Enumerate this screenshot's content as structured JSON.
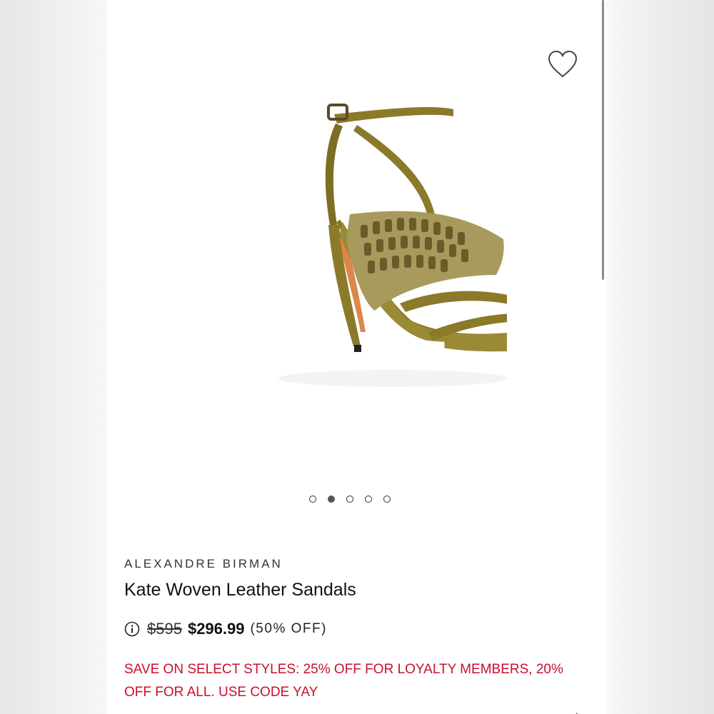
{
  "product": {
    "brand": "ALEXANDRE BIRMAN",
    "title": "Kate Woven Leather Sandals",
    "image_icon": "olive-strappy-sandal-image"
  },
  "price": {
    "original": "$595",
    "sale": "$296.99",
    "discount": "(50% OFF)",
    "info_icon": "info-icon"
  },
  "promo": {
    "text": "SAVE ON SELECT STYLES: 25% OFF FOR LOYALTY MEMBERS, 20% OFF FOR ALL. USE CODE YAY"
  },
  "carousel": {
    "total": 5,
    "active_index": 1
  },
  "actions": {
    "favorite_icon": "heart-outline-icon"
  },
  "colors": {
    "promo_red": "#c8102e",
    "sandal_olive": "#8a7a2a",
    "text_dark": "#111111"
  }
}
